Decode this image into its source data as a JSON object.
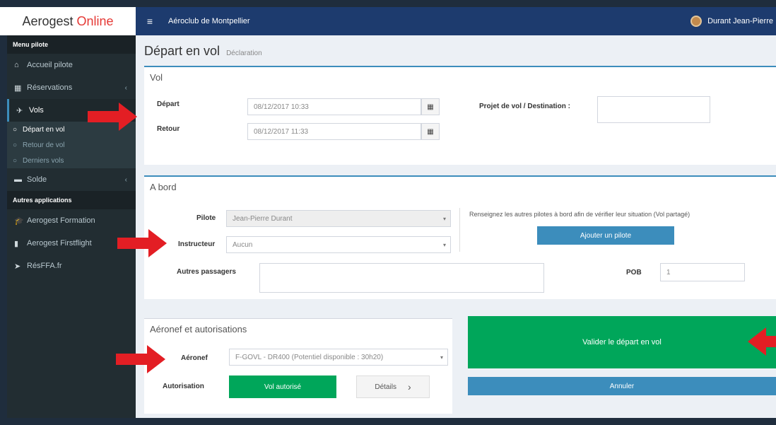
{
  "brand": {
    "part1": "Aerogest",
    "part2": "Online"
  },
  "navbar": {
    "menu_icon": "≡",
    "club": "Aéroclub de Montpellier",
    "user": "Durant Jean-Pierre"
  },
  "sidebar": {
    "header1": "Menu pilote",
    "items": [
      {
        "icon": "home-icon",
        "glyph": "⌂",
        "label": "Accueil pilote"
      },
      {
        "icon": "calendar-icon",
        "glyph": "▦",
        "label": "Réservations"
      },
      {
        "icon": "plane-icon",
        "glyph": "✈",
        "label": "Vols"
      }
    ],
    "sub": [
      {
        "label": "Départ en vol"
      },
      {
        "label": "Retour de vol"
      },
      {
        "label": "Derniers vols"
      }
    ],
    "solde": {
      "glyph": "▬",
      "label": "Solde"
    },
    "header2": "Autres applications",
    "apps": [
      {
        "glyph": "🎓",
        "label": "Aerogest Formation"
      },
      {
        "glyph": "▮",
        "label": "Aerogest Firstflight"
      },
      {
        "glyph": "➤",
        "label": "RésFFA.fr"
      }
    ]
  },
  "page": {
    "title": "Départ en vol",
    "subtitle": "Déclaration"
  },
  "vol": {
    "title": "Vol",
    "depart_label": "Départ",
    "depart_value": "08/12/2017 10:33",
    "retour_label": "Retour",
    "retour_value": "08/12/2017 11:33",
    "destination_label": "Projet de vol / Destination :",
    "cal_glyph": "▦"
  },
  "abord": {
    "title": "A bord",
    "pilote_label": "Pilote",
    "pilote_value": "Jean-Pierre Durant",
    "instructeur_label": "Instructeur",
    "instructeur_value": "Aucun",
    "autres_label": "Autres passagers",
    "pos_label": "POB",
    "pos_value": "1",
    "note": "Renseignez les autres pilotes à bord afin de vérifier leur situation (Vol partagé)",
    "add_button": "Ajouter un pilote",
    "arrow": "▾"
  },
  "aeronef": {
    "title": "Aéronef et autorisations",
    "aeronef_label": "Aéronef",
    "aeronef_value": "F-GOVL - DR400 (Potentiel disponible : 30h20)",
    "autorisation_label": "Autorisation",
    "autorisation_button": "Vol autorisé",
    "details_button": "Détails",
    "details_chevron": "›"
  },
  "actions": {
    "valider": "Valider le départ en vol",
    "annuler": "Annuler"
  },
  "colors": {
    "accent": "#3c8dbc",
    "green": "#00a65a",
    "navbar": "#1d3b6e",
    "arrow": "#e31e24"
  }
}
